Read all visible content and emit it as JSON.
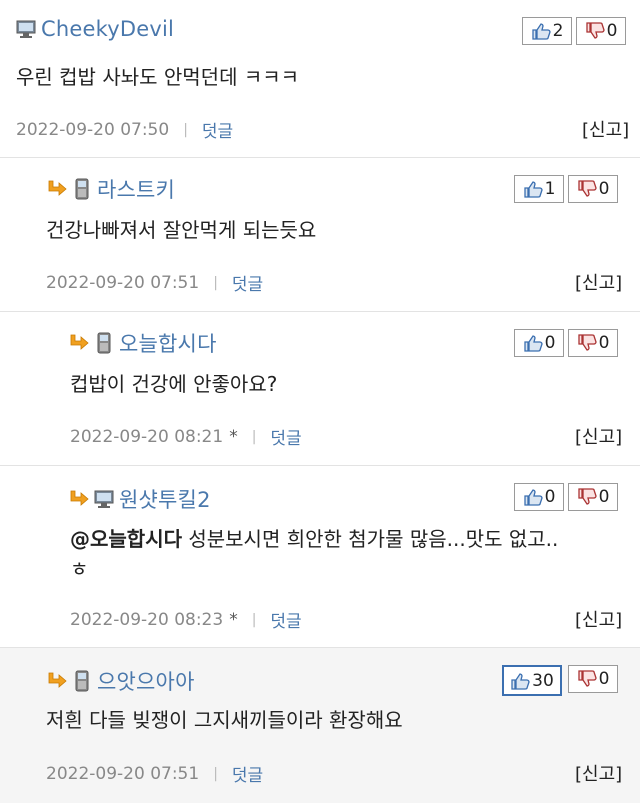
{
  "comments": [
    {
      "author": "CheekyDevil",
      "device_icon": "desktop-icon",
      "text": "우린 컵밥 사놔도 안먹던데 ㅋㅋㅋ",
      "date": "2022-09-20 07:50",
      "reply_label": "덧글",
      "report_label": "[신고]",
      "up": "2",
      "down": "0"
    },
    {
      "author": "라스트키",
      "device_icon": "mobile-icon",
      "text": "건강나빠져서 잘안먹게 되는듯요",
      "date": "2022-09-20 07:51",
      "reply_label": "덧글",
      "report_label": "[신고]",
      "up": "1",
      "down": "0"
    },
    {
      "author": "오늘합시다",
      "device_icon": "mobile-icon",
      "text": "컵밥이 건강에 안좋아요?",
      "date": "2022-09-20 08:21",
      "edited_mark": "*",
      "reply_label": "덧글",
      "report_label": "[신고]",
      "up": "0",
      "down": "0"
    },
    {
      "author": "원샷투킬2",
      "device_icon": "desktop-icon",
      "mention": "@오늘합시다",
      "text_line1": " 성분보시면 희안한 첨가물 많음...맛도 없고..",
      "text_line2": "ㅎ",
      "date": "2022-09-20 08:23",
      "edited_mark": "*",
      "reply_label": "덧글",
      "report_label": "[신고]",
      "up": "0",
      "down": "0"
    },
    {
      "author": "으앗으아아",
      "device_icon": "mobile-icon",
      "text": "저흰 다들 빚쟁이 그지새끼들이라 환장해요",
      "date": "2022-09-20 07:51",
      "reply_label": "덧글",
      "report_label": "[신고]",
      "up": "30",
      "down": "0"
    }
  ],
  "colors": {
    "author": "#4a78ac",
    "meta": "#888888",
    "highlight_bg": "#f5f5f5",
    "active_vote_border": "#3b6fb0"
  }
}
